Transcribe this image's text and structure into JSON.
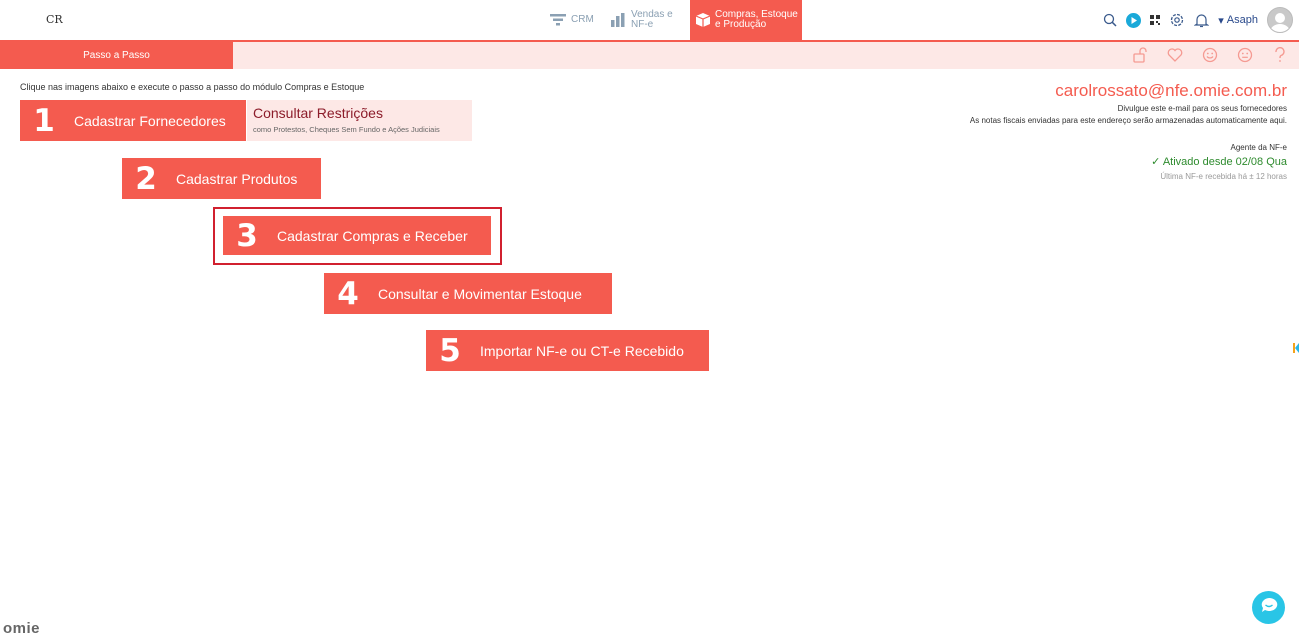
{
  "header": {
    "logo": "CR",
    "nav": {
      "crm": "CRM",
      "vendas": "Vendas e\nNF-e",
      "compras": "Compras, Estoque\ne Produção"
    },
    "user": "Asaph"
  },
  "subbar": {
    "tab_label": "Passo a Passo"
  },
  "content": {
    "intro": "Clique nas imagens abaixo e execute o passo a passo do módulo Compras e Estoque",
    "steps": [
      {
        "num": "1",
        "label": "Cadastrar Fornecedores"
      },
      {
        "num": "2",
        "label": "Cadastrar Produtos"
      },
      {
        "num": "3",
        "label": "Cadastrar Compras e Receber"
      },
      {
        "num": "4",
        "label": "Consultar e Movimentar Estoque"
      },
      {
        "num": "5",
        "label": "Importar NF-e ou CT-e Recebido"
      }
    ],
    "restricoes": {
      "title": "Consultar Restrições",
      "subtitle": "como Protestos, Cheques Sem Fundo e Ações Judiciais"
    }
  },
  "nfe_info": {
    "email": "carolrossato@nfe.omie.com.br",
    "line1": "Divulgue este e-mail para os seus fornecedores",
    "line2": "As notas fiscais enviadas para este endereço serão armazenadas automaticamente aqui.",
    "agent_label": "Agente da NF-e",
    "status": "Ativado desde 02/08 Qua",
    "last_received": "Última NF-e recebida há ± 12 horas"
  },
  "footer": {
    "brand": "omie"
  },
  "colors": {
    "accent": "#f45b4f",
    "accent_light": "#fde8e6",
    "highlight_border": "#d1202f",
    "success": "#2e8b2e",
    "chat": "#29c5e6"
  }
}
